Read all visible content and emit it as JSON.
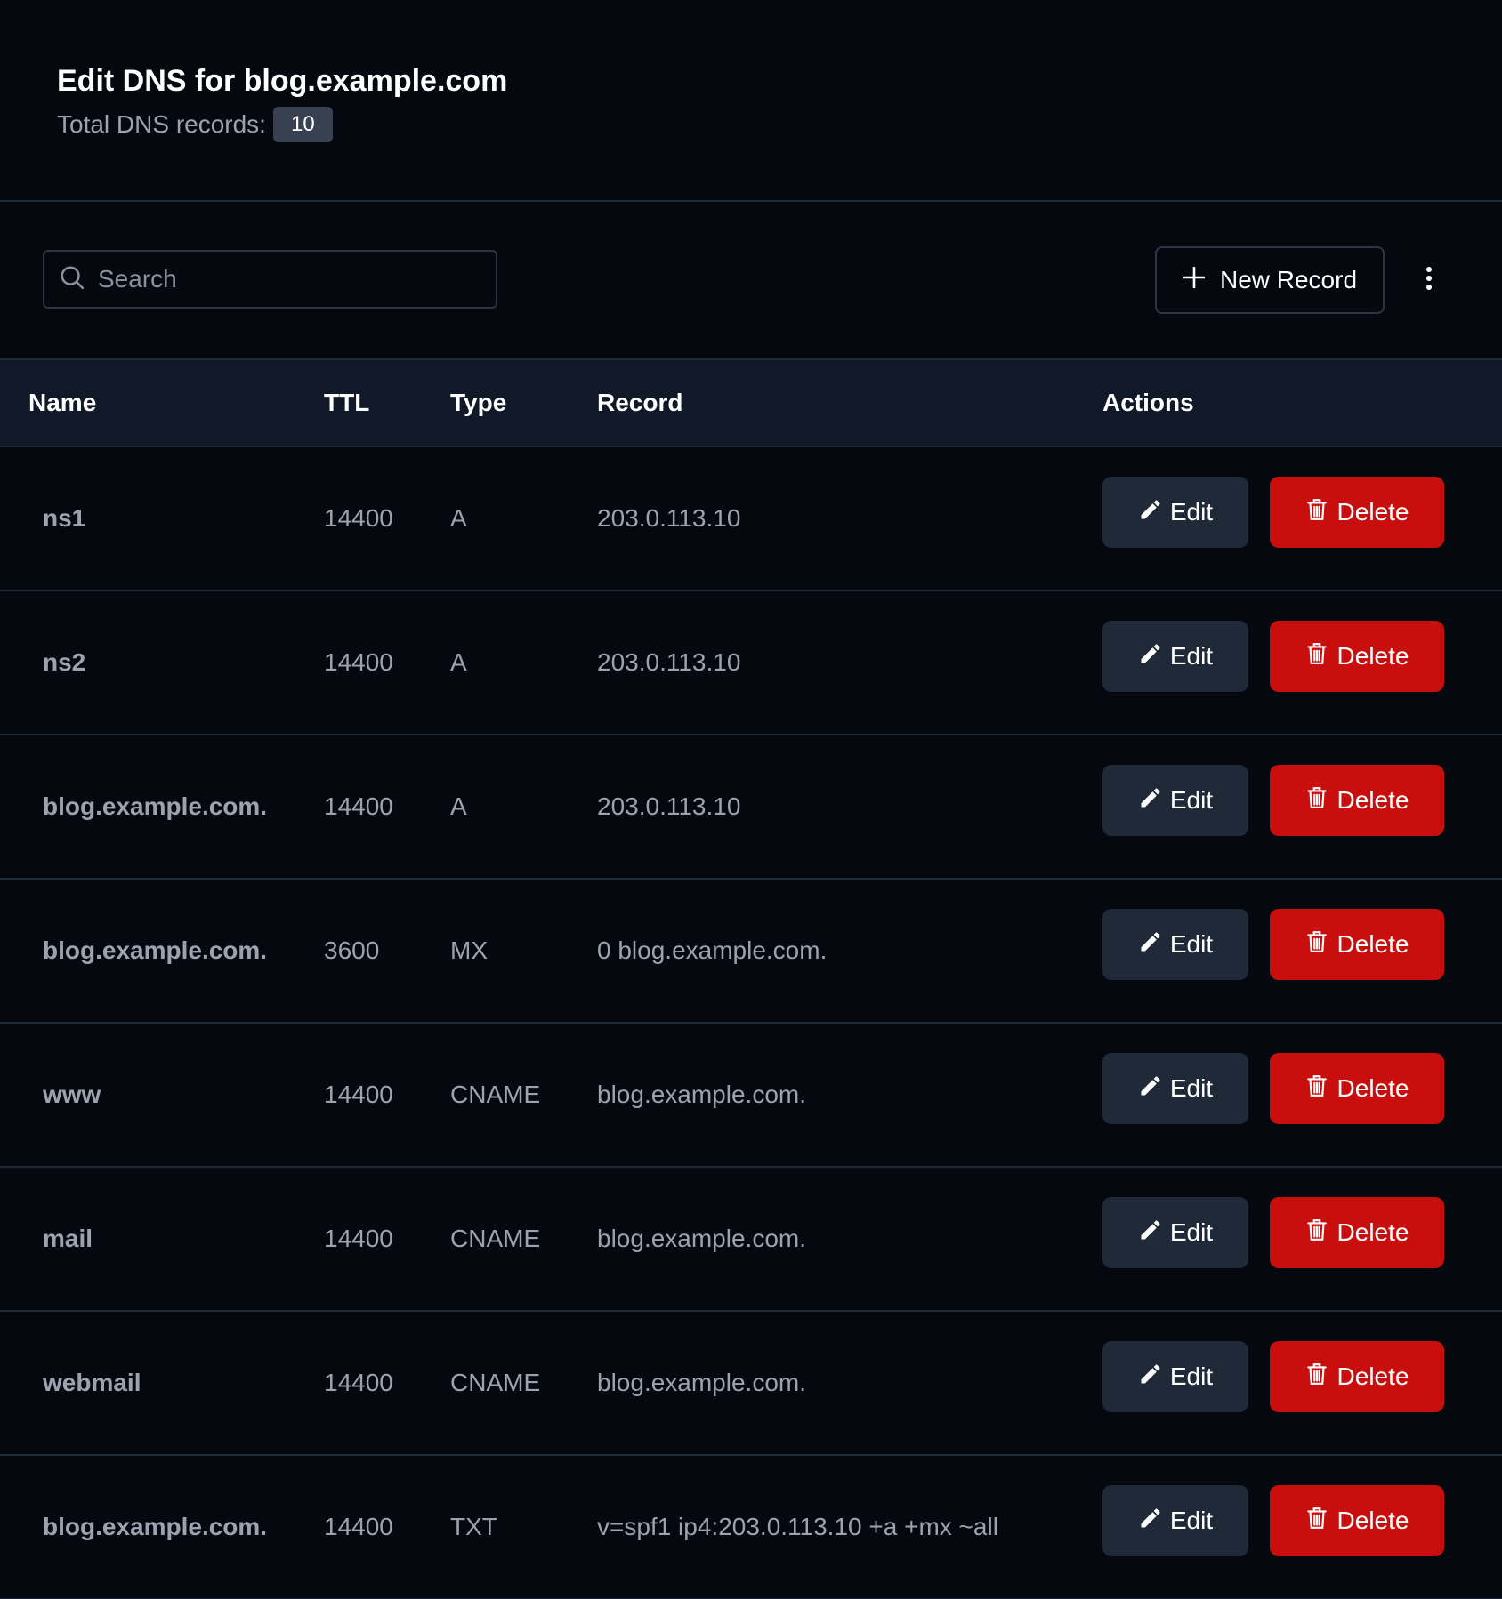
{
  "header": {
    "title": "Edit DNS for blog.example.com",
    "subtitle_label": "Total DNS records:",
    "record_count": "10"
  },
  "toolbar": {
    "search_placeholder": "Search",
    "new_record_label": "New Record"
  },
  "table": {
    "columns": [
      "Name",
      "TTL",
      "Type",
      "Record",
      "Actions"
    ],
    "edit_label": "Edit",
    "delete_label": "Delete",
    "rows": [
      {
        "name": "ns1",
        "ttl": "14400",
        "type": "A",
        "record": "203.0.113.10"
      },
      {
        "name": "ns2",
        "ttl": "14400",
        "type": "A",
        "record": "203.0.113.10"
      },
      {
        "name": "blog.example.com.",
        "ttl": "14400",
        "type": "A",
        "record": "203.0.113.10"
      },
      {
        "name": "blog.example.com.",
        "ttl": "3600",
        "type": "MX",
        "record": "0 blog.example.com."
      },
      {
        "name": "www",
        "ttl": "14400",
        "type": "CNAME",
        "record": "blog.example.com."
      },
      {
        "name": "mail",
        "ttl": "14400",
        "type": "CNAME",
        "record": "blog.example.com."
      },
      {
        "name": "webmail",
        "ttl": "14400",
        "type": "CNAME",
        "record": "blog.example.com."
      },
      {
        "name": "blog.example.com.",
        "ttl": "14400",
        "type": "TXT",
        "record": "v=spf1 ip4:203.0.113.10 +a +mx ~all"
      }
    ]
  },
  "icons": {
    "search": "search-icon",
    "plus": "plus-icon",
    "more": "more-vertical-icon",
    "edit": "pencil-icon",
    "delete": "trash-icon"
  },
  "colors": {
    "background": "#05080f",
    "header_row": "#111827",
    "edit_button": "#1f2937",
    "delete_button": "#c90e0e",
    "badge": "#374151"
  }
}
